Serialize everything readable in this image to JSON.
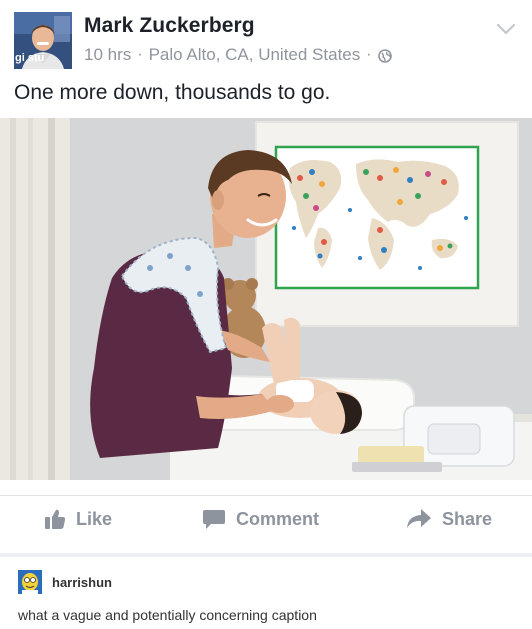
{
  "post": {
    "author_name": "Mark Zuckerberg",
    "avatar_overlay_text": "gi stu",
    "time_ago": "10 hrs",
    "location": "Palo Alto, CA, United States",
    "privacy_icon": "globe-icon",
    "options_icon": "chevron-down-icon",
    "status_text": "One more down, thousands to go."
  },
  "photo": {
    "subject": "photo-of-man-changing-baby-diaper-under-world-map"
  },
  "actions": {
    "like_label": "Like",
    "like_icon": "thumbs-up-icon",
    "comment_label": "Comment",
    "comment_icon": "speech-bubble-icon",
    "share_label": "Share",
    "share_icon": "share-arrow-icon"
  },
  "reblog": {
    "username": "harrishun",
    "comment": "what a vague and potentially concerning caption"
  },
  "colors": {
    "text_primary": "#1d2129",
    "text_secondary": "#90949c",
    "action_grey": "#8d949e",
    "map_border": "#2ea44f"
  }
}
